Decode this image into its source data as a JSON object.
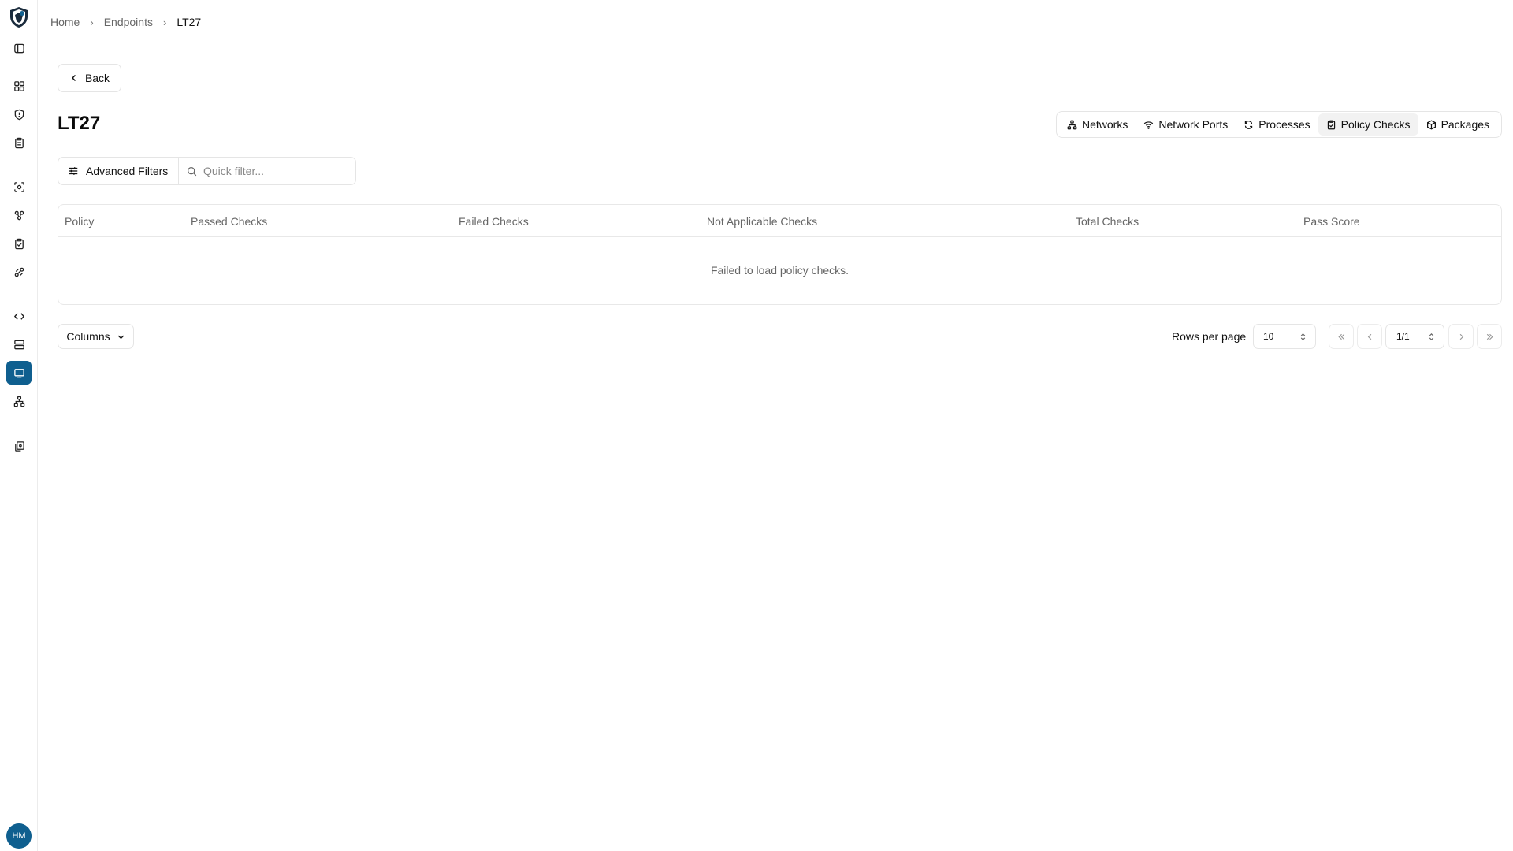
{
  "sidebar": {
    "items": [
      {
        "name": "sidebar-toggle",
        "icon": "panel-left-icon"
      },
      {
        "name": "dashboard",
        "icon": "grid-icon"
      },
      {
        "name": "security",
        "icon": "shield-icon"
      },
      {
        "name": "reports",
        "icon": "clipboard-icon"
      },
      {
        "name": "scan",
        "icon": "scan-icon"
      },
      {
        "name": "groups",
        "icon": "group-icon"
      },
      {
        "name": "compliance",
        "icon": "clipboard-check-icon"
      },
      {
        "name": "integrations",
        "icon": "plug-icon"
      },
      {
        "name": "code",
        "icon": "code-icon"
      },
      {
        "name": "servers",
        "icon": "server-icon"
      },
      {
        "name": "endpoints",
        "icon": "monitor-icon",
        "active": true
      },
      {
        "name": "network",
        "icon": "network-icon"
      },
      {
        "name": "documents",
        "icon": "files-icon"
      }
    ],
    "avatar_initials": "HM"
  },
  "breadcrumb": {
    "items": [
      "Home",
      "Endpoints",
      "LT27"
    ]
  },
  "back_label": "Back",
  "page_title": "LT27",
  "tabs": [
    {
      "label": "Networks",
      "icon": "network-icon"
    },
    {
      "label": "Network Ports",
      "icon": "wifi-icon"
    },
    {
      "label": "Processes",
      "icon": "refresh-icon"
    },
    {
      "label": "Policy Checks",
      "icon": "clipboard-check-icon",
      "active": true
    },
    {
      "label": "Packages",
      "icon": "package-icon"
    }
  ],
  "filters": {
    "advanced_label": "Advanced Filters",
    "quick_placeholder": "Quick filter..."
  },
  "table": {
    "columns": [
      "Policy",
      "Passed Checks",
      "Failed Checks",
      "Not Applicable Checks",
      "Total Checks",
      "Pass Score"
    ],
    "empty_message": "Failed to load policy checks."
  },
  "footer": {
    "columns_label": "Columns",
    "rows_per_page_label": "Rows per page",
    "rows_per_page_value": "10",
    "page_indicator": "1/1"
  },
  "colors": {
    "accent": "#0f5f8f",
    "border": "#e5e5e5",
    "muted_text": "#666666"
  }
}
